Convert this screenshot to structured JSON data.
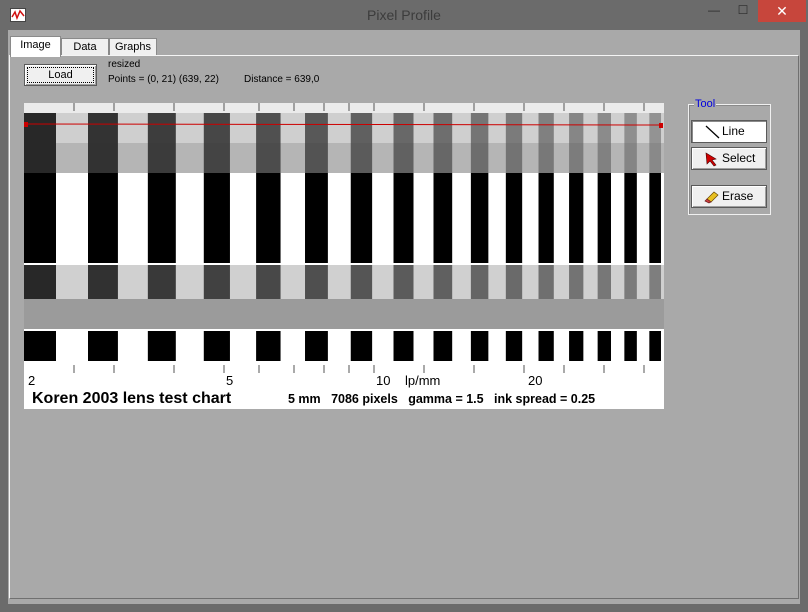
{
  "window": {
    "title": "Pixel Profile",
    "minimize_glyph": "—",
    "maximize_glyph": "☐",
    "close_glyph": "✕"
  },
  "tabs": [
    {
      "label": "Image",
      "active": true
    },
    {
      "label": "Data",
      "active": false
    },
    {
      "label": "Graphs",
      "active": false
    }
  ],
  "toolbar": {
    "load_label": "Load"
  },
  "info": {
    "status": "resized",
    "points": "Points = (0, 21)   (639, 22)",
    "distance": "Distance = 639,0"
  },
  "image": {
    "scale_labels": [
      "2",
      "5",
      "10",
      "lp/mm",
      "20"
    ],
    "caption_title": "Koren 2003 lens test chart",
    "caption_details": "5 mm   7086 pixels   gamma = 1.5   ink spread = 0.25",
    "profile_line_color": "#cc0000"
  },
  "tool": {
    "caption": "Tool",
    "buttons": [
      {
        "label": "Line",
        "icon": "line-icon",
        "active": true
      },
      {
        "label": "Select",
        "icon": "arrow-cursor-icon",
        "active": false
      },
      {
        "label": "Erase",
        "icon": "eraser-icon",
        "active": false
      }
    ]
  },
  "colors": {
    "window_frame": "#6b6b6b",
    "client_bg": "#a9a9a9",
    "close_button": "#c7463c",
    "tool_caption": "#0000e0"
  }
}
